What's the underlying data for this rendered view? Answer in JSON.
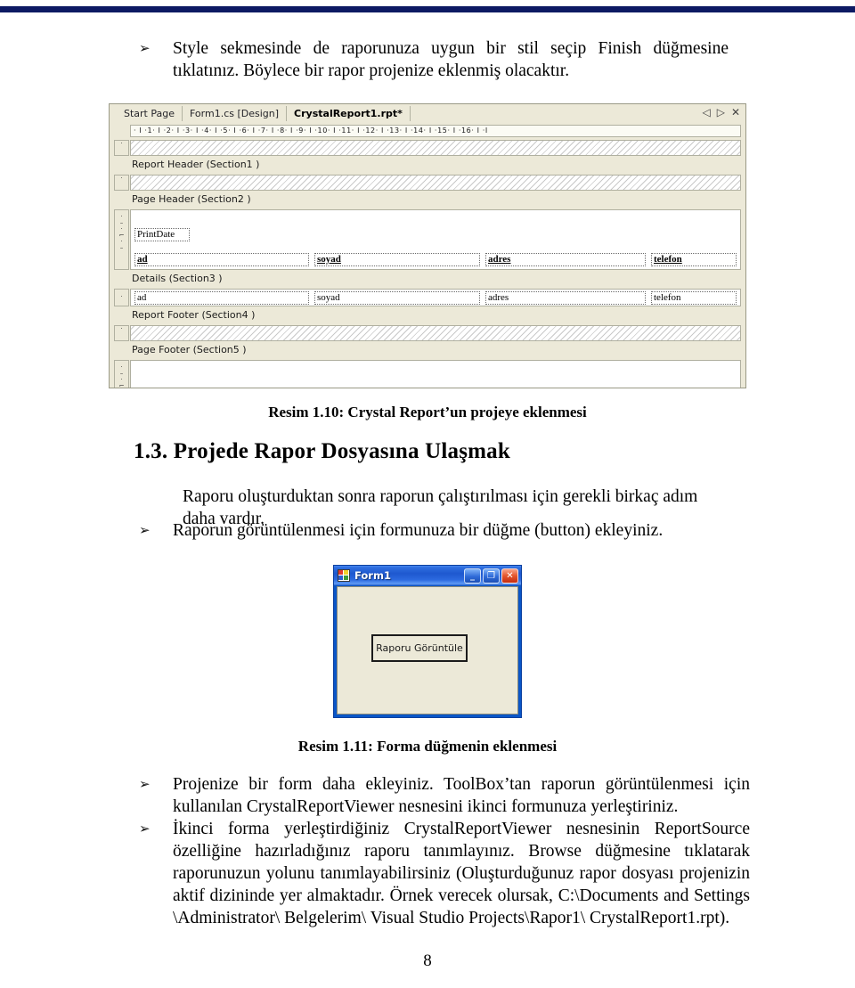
{
  "document": {
    "page_number": "8",
    "language": "tr"
  },
  "intro_bullet": {
    "glyph": "➢",
    "text": "Style sekmesinde de raporunuza uygun bir stil seçip Finish düğmesine tıklatınız. Böylece bir rapor projenize eklenmiş olacaktır."
  },
  "vs_designer": {
    "tabs": [
      {
        "label": "Start Page",
        "active": false
      },
      {
        "label": "Form1.cs [Design]",
        "active": false
      },
      {
        "label": "CrystalReport1.rpt*",
        "active": true
      }
    ],
    "tab_nav": {
      "prev_icon": "◁",
      "next_icon": "▷",
      "close_icon": "✕"
    },
    "ruler": "·  I  ·1·  I  ·2·  I  ·3·  I  ·4·  I  ·5·  I  ·6·  I  ·7·  I  ·8·  I  ·9·  I  ·10·  I  ·11·  I  ·12·  I  ·13·  I  ·14·  I  ·15·  I  ·16·  I  ·I",
    "sections": [
      {
        "label": "Report Header  (Section1 )"
      },
      {
        "label": "Page Header  (Section2 )"
      },
      {
        "label": "Details  (Section3 )"
      },
      {
        "label": "Report Footer  (Section4 )"
      },
      {
        "label": "Page Footer  (Section5 )"
      }
    ],
    "page_header_fields": [
      {
        "text": "PrintDate"
      },
      {
        "text": "ad"
      },
      {
        "text": "soyad"
      },
      {
        "text": "adres"
      },
      {
        "text": "telefon"
      }
    ],
    "details_fields": [
      {
        "text": "ad"
      },
      {
        "text": "soyad"
      },
      {
        "text": "adres"
      },
      {
        "text": "telefon"
      }
    ],
    "gutter_marks": "·\n–\n·\n⌐\n·\n–"
  },
  "caption_1": "Resim 1.10: Crystal Report’un projeye eklenmesi",
  "heading_1": "1.3. Projede Rapor Dosyasına Ulaşmak",
  "paragraph_1": "Raporu oluşturduktan sonra raporun çalıştırılması için gerekli birkaç adım daha vardır.",
  "bullet_2": {
    "glyph": "➢",
    "text": "Raporun görüntülenmesi için formunuza bir düğme (button) ekleyiniz."
  },
  "xp_form": {
    "title": "Form1",
    "minimize_label": "_",
    "maximize_label": "❐",
    "close_label": "✕",
    "button_label": "Raporu Görüntüle"
  },
  "caption_2": "Resim 1.11: Forma düğmenin eklenmesi",
  "bullet_3": {
    "glyph": "➢",
    "text": "Projenize bir form daha ekleyiniz. ToolBox’tan raporun görüntülenmesi için kullanılan CrystalReportViewer nesnesini ikinci formunuza yerleştiriniz."
  },
  "bullet_4": {
    "glyph": "➢",
    "text": "İkinci forma yerleştirdiğiniz CrystalReportViewer nesnesinin ReportSource özelliğine hazırladığınız raporu tanımlayınız. Browse düğmesine tıklatarak raporunuzun yolunu tanımlayabilirsiniz (Oluşturduğunuz rapor dosyası projenizin aktif dizininde yer almaktadır. Örnek verecek olursak, C:\\Documents and Settings \\Administrator\\ Belgelerim\\ Visual Studio Projects\\Rapor1\\ CrystalReport1.rpt)."
  },
  "colors": {
    "rule": "#0d1a63",
    "vs_chrome": "#ECE9D8",
    "xp_title_blue": "#2f6fe0",
    "xp_close_red": "#e4552c"
  }
}
